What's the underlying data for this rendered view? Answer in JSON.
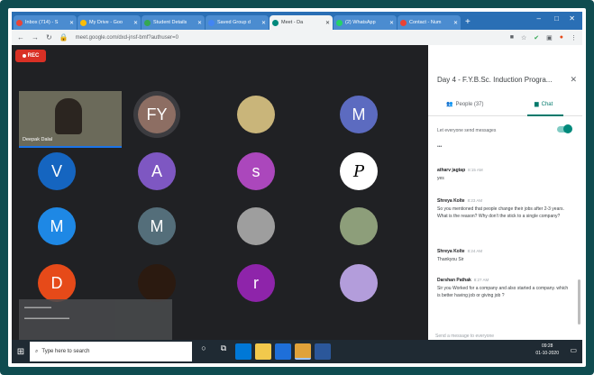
{
  "browser": {
    "tabs": [
      {
        "label": "Inbox (714) - S",
        "color": "#ea4335",
        "active": false
      },
      {
        "label": "My Drive - Goo",
        "color": "#fbbc04",
        "active": false
      },
      {
        "label": "Student Details",
        "color": "#34a853",
        "active": false
      },
      {
        "label": "Saved Group d",
        "color": "#4285f4",
        "active": false
      },
      {
        "label": "Meet - Da",
        "color": "#00897b",
        "active": true
      },
      {
        "label": "(2) WhatsApp",
        "color": "#25d366",
        "active": false
      },
      {
        "label": "Contact - Num",
        "color": "#ea4335",
        "active": false
      }
    ],
    "new_tab": "+",
    "url": "meet.google.com/dxd-jnsf-bmf?authuser=0",
    "window_controls": [
      "–",
      "□",
      "✕"
    ]
  },
  "meet": {
    "rec_label": "REC",
    "self_name": "Deepak Dalal",
    "tiles": [
      {
        "type": "avatar",
        "letter": "FY",
        "color": "#8d6e63"
      },
      {
        "type": "photo",
        "color": "#c9b57a"
      },
      {
        "type": "avatar",
        "letter": "M",
        "color": "#5c6bc0"
      },
      {
        "type": "avatar",
        "letter": "V",
        "color": "#1565c0"
      },
      {
        "type": "avatar",
        "letter": "A",
        "color": "#7e57c2"
      },
      {
        "type": "avatar",
        "letter": "s",
        "color": "#ab47bc"
      },
      {
        "type": "photo",
        "color": "#ffffff",
        "glyph": "P"
      },
      {
        "type": "avatar",
        "letter": "M",
        "color": "#1e88e5"
      },
      {
        "type": "avatar",
        "letter": "M",
        "color": "#546e7a"
      },
      {
        "type": "photo",
        "color": "#9e9e9e"
      },
      {
        "type": "photo",
        "color": "#8d9e7a"
      },
      {
        "type": "avatar",
        "letter": "D",
        "color": "#e64a19"
      },
      {
        "type": "photo",
        "color": "#2b1a10"
      },
      {
        "type": "avatar",
        "letter": "r",
        "color": "#8e24aa"
      },
      {
        "type": "photo",
        "color": "#b39ddb"
      }
    ]
  },
  "chat": {
    "title": "Day 4 - F.Y.B.Sc. Induction Progra...",
    "tab_people": "People (37)",
    "tab_chat": "Chat",
    "setting": "Let everyone send messages",
    "ellipsis": "•••",
    "messages": [
      {
        "sender": "atharv jagtap",
        "time": "8:15 AM",
        "text": "yes"
      },
      {
        "sender": "Shreya Kolte",
        "time": "8:23 AM",
        "text": "So you mentioned that people change their jobs after 2-3 years. What is the reason? Why don't the stick to a single company?"
      },
      {
        "sender": "Shreya Kolte",
        "time": "8:24 AM",
        "text": "Thankyou Sir"
      },
      {
        "sender": "Darshan Pathak",
        "time": "8:27 AM",
        "text": "Sir you Worked for a company and also started a company. which is better having job or giving job ?"
      }
    ],
    "input_placeholder": "Send a message to everyone"
  },
  "taskbar": {
    "search_placeholder": "Type here to search",
    "time": "09:28",
    "date": "01-10-2020"
  }
}
